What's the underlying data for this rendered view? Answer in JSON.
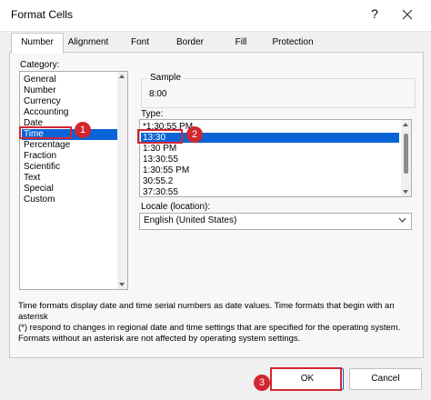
{
  "window": {
    "title": "Format Cells",
    "help": "?"
  },
  "tabs": [
    {
      "label": "Number"
    },
    {
      "label": "Alignment"
    },
    {
      "label": "Font"
    },
    {
      "label": "Border"
    },
    {
      "label": "Fill"
    },
    {
      "label": "Protection"
    }
  ],
  "category": {
    "label": "Category:",
    "items": [
      "General",
      "Number",
      "Currency",
      "Accounting",
      "Date",
      "Time",
      "Percentage",
      "Fraction",
      "Scientific",
      "Text",
      "Special",
      "Custom"
    ],
    "selected": "Time"
  },
  "sample": {
    "label": "Sample",
    "value": "8:00"
  },
  "type": {
    "label": "Type:",
    "items": [
      "*1:30:55 PM",
      "13:30",
      "1:30 PM",
      "13:30:55",
      "1:30:55 PM",
      "30:55.2",
      "37:30:55"
    ],
    "selected": "13:30"
  },
  "locale": {
    "label": "Locale (location):",
    "value": "English (United States)"
  },
  "description": {
    "line1": "Time formats display date and time serial numbers as date values.  Time formats that begin with an asterisk",
    "line2": "(*) respond to changes in regional date and time settings that are specified for the operating system.",
    "line3": "Formats without an asterisk are not affected by operating system settings."
  },
  "buttons": {
    "ok": "OK",
    "cancel": "Cancel"
  },
  "annotations": {
    "badge1": "1",
    "badge2": "2",
    "badge3": "3"
  },
  "colors": {
    "selection": "#0a64d8",
    "annotation": "#d22630"
  }
}
